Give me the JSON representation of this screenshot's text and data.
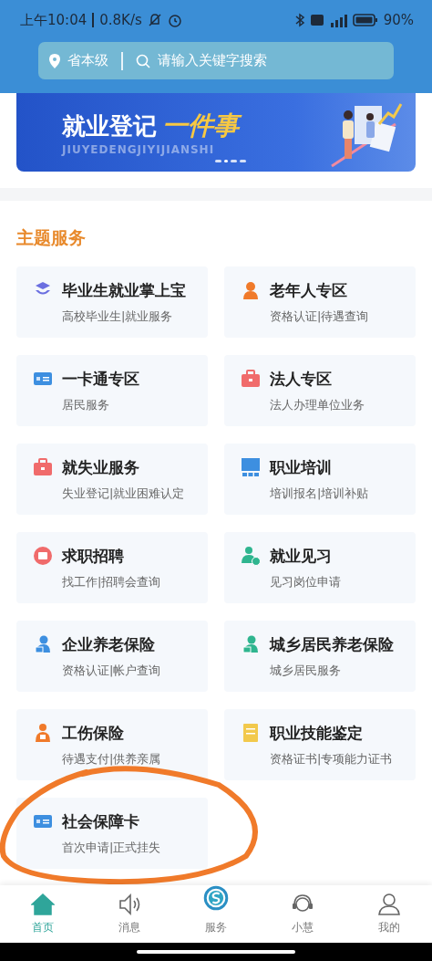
{
  "status_bar": {
    "time": "上午10:04",
    "speed": "0.8K/s",
    "battery": "90%"
  },
  "search": {
    "region": "省本级",
    "placeholder": "请输入关键字搜索"
  },
  "banner": {
    "title": "就业登记",
    "highlight": "一件事",
    "pinyin": "JIUYEDENGJIYIJIANSHI",
    "dots": [
      {
        "selected": false
      },
      {
        "selected": true
      },
      {
        "selected": false
      },
      {
        "selected": false
      }
    ]
  },
  "section_title": "主题服务",
  "services": [
    {
      "title": "毕业生就业掌上宝",
      "subtitle": "高校毕业生|就业服务",
      "kind": "graduate",
      "color": "#6b6fe0"
    },
    {
      "title": "老年人专区",
      "subtitle": "资格认证|待遇查询",
      "kind": "elder",
      "color": "#f07a2a"
    },
    {
      "title": "一卡通专区",
      "subtitle": "居民服务",
      "kind": "card",
      "color": "#3d8fe0"
    },
    {
      "title": "法人专区",
      "subtitle": "法人办理单位业务",
      "kind": "briefcase",
      "color": "#f06b6b"
    },
    {
      "title": "就失业服务",
      "subtitle": "失业登记|就业困难认定",
      "kind": "briefcase",
      "color": "#f06b6b"
    },
    {
      "title": "职业培训",
      "subtitle": "培训报名|培训补贴",
      "kind": "training",
      "color": "#3d8fe0"
    },
    {
      "title": "求职招聘",
      "subtitle": "找工作|招聘会查询",
      "kind": "hire",
      "color": "#f06b6b"
    },
    {
      "title": "就业见习",
      "subtitle": "见习岗位申请",
      "kind": "intern",
      "color": "#2fb58f"
    },
    {
      "title": "企业养老保险",
      "subtitle": "资格认证|帐户查询",
      "kind": "pension",
      "color": "#3d8fe0"
    },
    {
      "title": "城乡居民养老保险",
      "subtitle": "城乡居民服务",
      "kind": "pension",
      "color": "#2fb58f"
    },
    {
      "title": "工伤保险",
      "subtitle": "待遇支付|供养亲属",
      "kind": "worker",
      "color": "#f07a2a"
    },
    {
      "title": "职业技能鉴定",
      "subtitle": "资格证书|专项能力证书",
      "kind": "certificate",
      "color": "#f2c94c"
    },
    {
      "title": "社会保障卡",
      "subtitle": "首次申请|正式挂失",
      "kind": "card",
      "color": "#3d8fe0"
    }
  ],
  "annotation": {
    "kind": "ellipse",
    "color": "#f07a2a"
  },
  "nav": [
    {
      "label": "首页",
      "kind": "home",
      "selected": true
    },
    {
      "label": "消息",
      "kind": "speaker",
      "selected": false
    },
    {
      "label": "服务",
      "kind": "logo",
      "selected": false
    },
    {
      "label": "小慧",
      "kind": "headset",
      "selected": false
    },
    {
      "label": "我的",
      "kind": "user",
      "selected": false
    }
  ]
}
